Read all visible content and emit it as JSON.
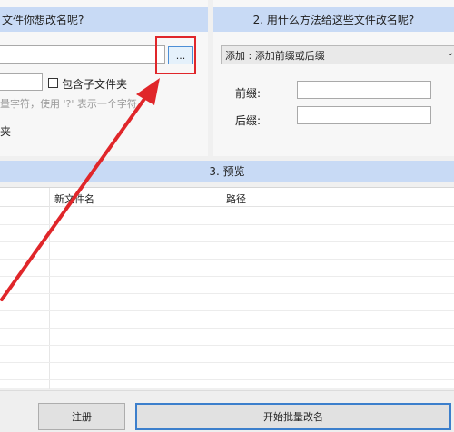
{
  "left_panel": {
    "title": "文件你想改名呢?",
    "browse_label": "...",
    "include_subfolders_label": "包含子文件夹",
    "hint_text": "量字符，使用 '?' 表示一个字符。",
    "partial_label": "夹"
  },
  "right_panel": {
    "title": "2. 用什么方法给这些文件改名呢?",
    "method_value": "添加 : 添加前缀或后缀",
    "prefix_label": "前缀:",
    "suffix_label": "后缀:",
    "prefix_value": "",
    "suffix_value": ""
  },
  "preview": {
    "title": "3. 预览",
    "columns": [
      "",
      "新文件名",
      "路径"
    ]
  },
  "footer": {
    "register_label": "注册",
    "start_label": "开始批量改名"
  },
  "colors": {
    "header_bg": "#c8daf5",
    "highlight": "#e0262a"
  }
}
